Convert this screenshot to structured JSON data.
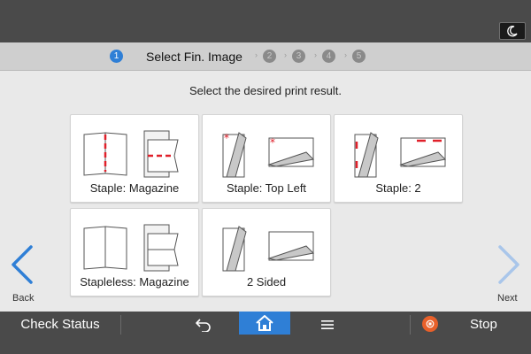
{
  "header": {
    "moon_icon": "moon-icon"
  },
  "steps": {
    "current": "1",
    "current_title": "Select Fin. Image",
    "upcoming": [
      "2",
      "3",
      "4",
      "5"
    ]
  },
  "instruction": "Select the desired print result.",
  "options": [
    {
      "label": "Staple: Magazine"
    },
    {
      "label": "Staple: Top Left"
    },
    {
      "label": "Staple: 2"
    },
    {
      "label": "Stapleless: Magazine"
    },
    {
      "label": "2 Sided"
    }
  ],
  "nav": {
    "back_label": "Back",
    "next_label": "Next"
  },
  "footer": {
    "check_status_label": "Check Status",
    "stop_label": "Stop",
    "icons": [
      "back-arrow-icon",
      "home-icon",
      "menu-icon",
      "stop-icon"
    ]
  },
  "colors": {
    "accent": "#2f7fd6",
    "staple_red": "#e0202a",
    "stop_orange": "#e8602a",
    "bar_dark": "#4a4a4a"
  }
}
